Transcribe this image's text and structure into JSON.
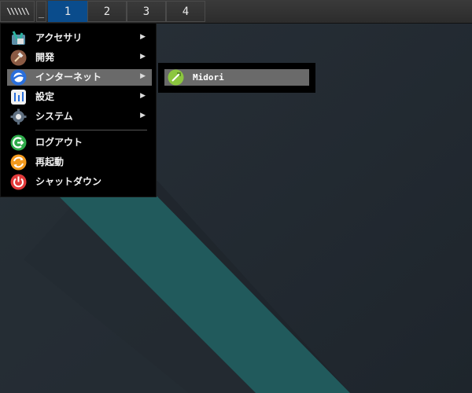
{
  "panel": {
    "menu_button_glyph": "\\\\\\\\\\\\",
    "minimize_glyph": "_",
    "workspaces": [
      {
        "label": "1",
        "active": true
      },
      {
        "label": "2",
        "active": false
      },
      {
        "label": "3",
        "active": false
      },
      {
        "label": "4",
        "active": false
      }
    ],
    "active_color": "#0a4c8c"
  },
  "menu": {
    "items": [
      {
        "label": "アクセサリ",
        "icon": "accessories-icon",
        "has_submenu": true
      },
      {
        "label": "開発",
        "icon": "development-hammer-icon",
        "has_submenu": true
      },
      {
        "label": "インターネット",
        "icon": "internet-globe-icon",
        "has_submenu": true,
        "selected": true
      },
      {
        "label": "設定",
        "icon": "settings-icon",
        "has_submenu": true
      },
      {
        "label": "システム",
        "icon": "system-gear-icon",
        "has_submenu": true
      },
      {
        "label": "ログアウト",
        "icon": "logout-icon",
        "has_submenu": false
      },
      {
        "label": "再起動",
        "icon": "reboot-icon",
        "has_submenu": false
      },
      {
        "label": "シャットダウン",
        "icon": "shutdown-icon",
        "has_submenu": false
      }
    ],
    "submenu_arrow": "▶"
  },
  "submenu": {
    "items": [
      {
        "label": "Midori",
        "icon": "midori-icon"
      }
    ]
  },
  "colors": {
    "wallpaper_dark": "#232a32",
    "wallpaper_teal": "#205a5c",
    "menu_bg": "#000000",
    "selection_bg": "#6a6a6a"
  }
}
